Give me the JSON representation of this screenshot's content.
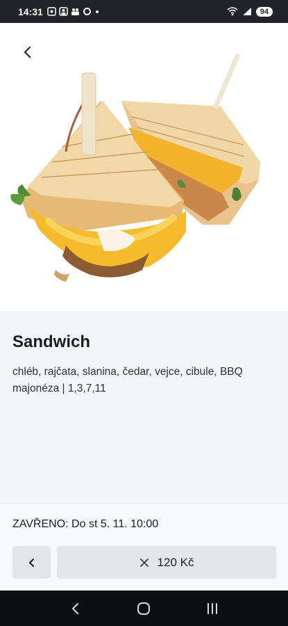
{
  "status_bar": {
    "time": "14:31",
    "left_icons": [
      "screenshot-icon",
      "selfie-icon",
      "teams-icon",
      "o-icon",
      "dot-icon"
    ],
    "right_icons": [
      "wifi-icon",
      "signal-icon"
    ],
    "battery": "94"
  },
  "product": {
    "title": "Sandwich",
    "description": "chléb, rajčata, slanina, čedar, vejce, cibule, BBQ majonéza | 1,3,7,11"
  },
  "footer": {
    "status": "ZAVŘENO: Do st 5. 11. 10:00",
    "price_label": "120 Kč"
  },
  "colors": {
    "status_bar": "#23242a",
    "button_bg": "#e3e5e9",
    "page_bg": "#f4f5f8",
    "nav_bar": "#0e0f12"
  }
}
